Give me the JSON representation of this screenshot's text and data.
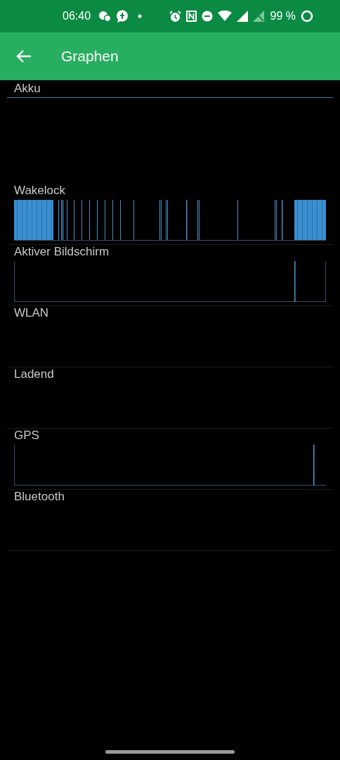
{
  "status_bar": {
    "time": "06:40",
    "battery": "99 %"
  },
  "app_bar": {
    "title": "Graphen"
  },
  "graphs": [
    {
      "label": "Akku",
      "kind": "battery-line"
    },
    {
      "label": "Wakelock",
      "kind": "dense-bars"
    },
    {
      "label": "Aktiver Bildschirm",
      "kind": "screen-spikes"
    },
    {
      "label": "WLAN",
      "kind": "empty"
    },
    {
      "label": "Ladend",
      "kind": "empty"
    },
    {
      "label": "GPS",
      "kind": "gps-spike"
    },
    {
      "label": "Bluetooth",
      "kind": "empty"
    }
  ]
}
